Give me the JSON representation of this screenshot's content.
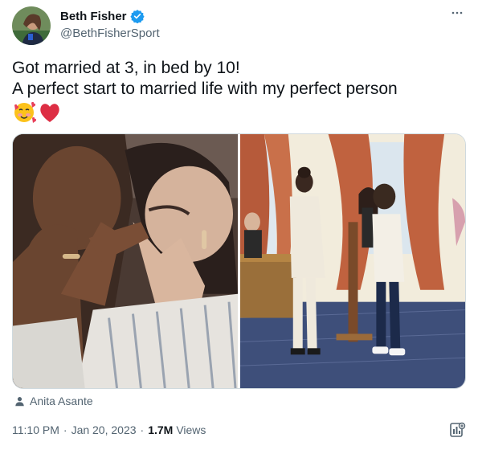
{
  "author": {
    "display_name": "Beth Fisher",
    "handle": "@BethFisherSport",
    "verified": true,
    "verified_color": "#1d9bf0"
  },
  "more_icon": "more-dots-icon",
  "tweet": {
    "line1": "Got married at 3, in bed by 10!",
    "line2": "A perfect start to married life with my perfect person",
    "emojis": [
      "🥰",
      "❤️"
    ]
  },
  "media": {
    "photo_count": 2
  },
  "tagged_user": "Anita Asante",
  "meta": {
    "time": "11:10 PM",
    "date": "Jan 20, 2023",
    "views_count": "1.7M",
    "views_label": "Views"
  },
  "colors": {
    "text": "#0f1419",
    "secondary": "#536471",
    "border": "#cfd9de"
  }
}
